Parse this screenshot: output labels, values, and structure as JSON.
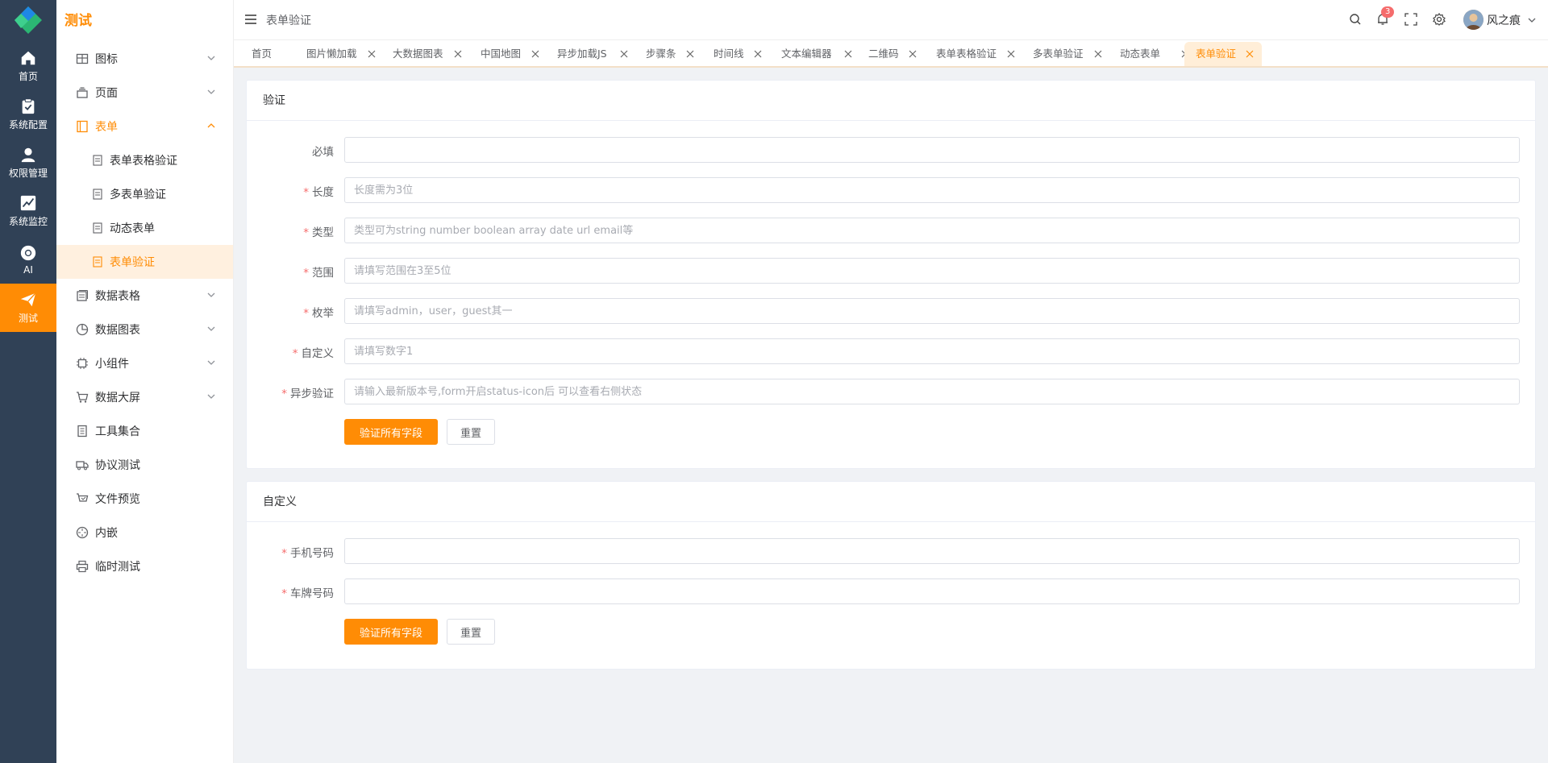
{
  "rail": {
    "items": [
      {
        "label": "首页",
        "icon": "home-icon"
      },
      {
        "label": "系统配置",
        "icon": "clipboard-icon"
      },
      {
        "label": "权限管理",
        "icon": "user-icon"
      },
      {
        "label": "系统监控",
        "icon": "chart-icon"
      },
      {
        "label": "AI",
        "icon": "chrome-icon"
      },
      {
        "label": "测试",
        "icon": "paper-plane-icon"
      }
    ]
  },
  "sidebar": {
    "title": "测试",
    "items": [
      {
        "label": "图标"
      },
      {
        "label": "页面"
      },
      {
        "label": "表单"
      },
      {
        "label": "表单表格验证"
      },
      {
        "label": "多表单验证"
      },
      {
        "label": "动态表单"
      },
      {
        "label": "表单验证"
      },
      {
        "label": "数据表格"
      },
      {
        "label": "数据图表"
      },
      {
        "label": "小组件"
      },
      {
        "label": "数据大屏"
      },
      {
        "label": "工具集合"
      },
      {
        "label": "协议测试"
      },
      {
        "label": "文件预览"
      },
      {
        "label": "内嵌"
      },
      {
        "label": "临时测试"
      }
    ]
  },
  "header": {
    "breadcrumb": "表单验证",
    "notification_count": "3",
    "username": "风之痕"
  },
  "tabs": [
    "首页",
    "图片懒加载",
    "大数据图表",
    "中国地图",
    "异步加载JS",
    "步骤条",
    "时间线",
    "文本编辑器",
    "二维码",
    "表单表格验证",
    "多表单验证",
    "动态表单",
    "表单验证"
  ],
  "card1": {
    "title": "验证",
    "fields": [
      {
        "label": "必填",
        "required": false,
        "placeholder": ""
      },
      {
        "label": "长度",
        "required": true,
        "placeholder": "长度需为3位"
      },
      {
        "label": "类型",
        "required": true,
        "placeholder": "类型可为string number boolean array date url email等"
      },
      {
        "label": "范围",
        "required": true,
        "placeholder": "请填写范围在3至5位"
      },
      {
        "label": "枚举",
        "required": true,
        "placeholder": "请填写admin，user，guest其一"
      },
      {
        "label": "自定义",
        "required": true,
        "placeholder": "请填写数字1"
      },
      {
        "label": "异步验证",
        "required": true,
        "placeholder": "请输入最新版本号,form开启status-icon后 可以查看右侧状态"
      }
    ],
    "submit_label": "验证所有字段",
    "reset_label": "重置"
  },
  "card2": {
    "title": "自定义",
    "fields": [
      {
        "label": "手机号码",
        "required": true,
        "placeholder": ""
      },
      {
        "label": "车牌号码",
        "required": true,
        "placeholder": ""
      }
    ],
    "submit_label": "验证所有字段",
    "reset_label": "重置"
  },
  "colors": {
    "accent": "#ff8c05",
    "rail_bg": "#304156",
    "required": "#f56c6c"
  }
}
